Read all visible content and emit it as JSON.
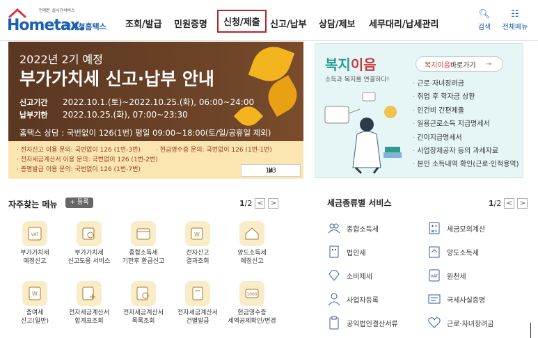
{
  "header": {
    "logo_tagline": "언제든 실시간서비스",
    "logo_text": "Hometax.",
    "logo_sub": "국세청홈택스",
    "nav": [
      "조회/발급",
      "민원증명",
      "신청/제출",
      "신고/납부",
      "상담/제보",
      "세무대리/납세관리"
    ],
    "search_label": "검색",
    "allmenu_label": "전체메뉴"
  },
  "banner": {
    "subtitle": "2022년 2기 예정",
    "title": "부가가치세 신고·납부 안내",
    "period_label": "신고기간",
    "period_value": "2022.10.1.(토)~2022.10.25.(화), 06:00~24:00",
    "deadline_label": "납부기한",
    "deadline_value": "2022.10.25.(화), 07:00~23:30",
    "consult": "홈택스 상담 : 국번없이 126(1번)  평일 09:00~18:00(토/일/공휴일 제외)",
    "notes": [
      "· 전자신고 이용 문의: 국번없이 126 (1번-3번)",
      "· 현금영수증 문의: 국번없이 126 (1번-1번)",
      "· 전자세금계산서 이용 문의: 국번없이 126 (1번-2번)",
      "· 증명발급 이용 문의: 국번없이 126 (1번-7번)"
    ],
    "page": "1/3",
    "prev": "<",
    "pause": "II",
    "next": ">"
  },
  "promo": {
    "title_a": "복지",
    "title_b": "이음",
    "desc": "소득과 복지를 연결하다!",
    "go_hl": "복지이음",
    "go_rest": " 바로가기",
    "items": [
      "근로·자녀장려금",
      "취업 후 학자금 상환",
      "인건비 간편제출",
      "일용근로소득 지급명세서",
      "간이지급명세서",
      "사업장제공자 등의 과세자료",
      "본인 소득내역 확인(근로·인적용역)"
    ]
  },
  "favorites": {
    "title": "자주찾는 메뉴",
    "add": "+ 등록",
    "page_cur": "1",
    "page_total": "/2",
    "items": [
      "부가가치세\n예정신고",
      "부가가치세\n신고도움 서비스",
      "종합소득세\n기한후 환급신고",
      "전자신고\n결과조회",
      "양도소득세\n예정신고",
      "증여세\n신고(일반)",
      "전자세금계산서\n합계표조회",
      "전자세금계산서\n목록조회",
      "전자세금계산서\n건별발급",
      "현금영수증\n세액공제확인/변경"
    ]
  },
  "tax_services": {
    "title": "세금종류별 서비스",
    "page_cur": "1",
    "page_total": "/2",
    "left": [
      "종합소득세",
      "법인세",
      "소비제세",
      "사업자등록",
      "공익법인결산서류"
    ],
    "right": [
      "세금모의계산",
      "양도소득세",
      "원천세",
      "국세사실증명",
      "근로·자녀장려금"
    ]
  },
  "colors": {
    "brand": "#1b5fb0",
    "banner_bg": "#5a3721",
    "accent_red": "#b5232a",
    "promo_bg": "#e6f6f6"
  }
}
